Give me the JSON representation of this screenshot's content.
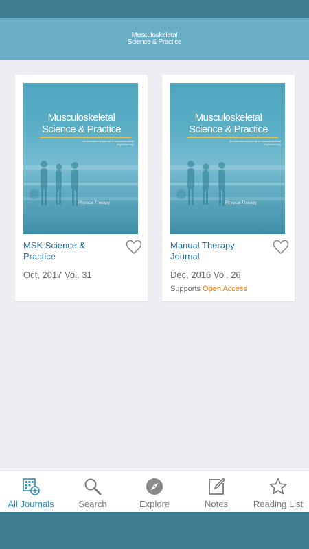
{
  "header": {
    "logo_line1": "Musculoskeletal",
    "logo_line2": "Science & Practice"
  },
  "journals": [
    {
      "title": "MSK Science & Practice",
      "issue": "Oct, 2017 Vol. 31",
      "cover_title_line1": "Musculoskeletal",
      "cover_title_line2": "Science & Practice",
      "cover_subtitle": "An international journal of musculoskeletal physiotherapy",
      "cover_footer": "Physical Therapy",
      "favorite": false
    },
    {
      "title": "Manual Therapy Journal",
      "issue": "Dec, 2016 Vol. 26",
      "supports_prefix": "Supports ",
      "supports_link": "Open Access",
      "cover_title_line1": "Musculoskeletal",
      "cover_title_line2": "Science & Practice",
      "cover_subtitle": "An international journal of musculoskeletal physiotherapy",
      "cover_footer": "Physical Therapy",
      "favorite": false
    }
  ],
  "tabs": [
    {
      "label": "All Journals",
      "icon": "journals-grid-icon",
      "active": true
    },
    {
      "label": "Search",
      "icon": "search-icon",
      "active": false
    },
    {
      "label": "Explore",
      "icon": "compass-icon",
      "active": false
    },
    {
      "label": "Notes",
      "icon": "note-edit-icon",
      "active": false
    },
    {
      "label": "Reading List",
      "icon": "star-icon",
      "active": false
    }
  ],
  "colors": {
    "header": "#6aaec6",
    "status_bar": "#3f7d93",
    "accent": "#2f8fbf",
    "open_access": "#ef7d1a",
    "title_link": "#1e74a8"
  }
}
